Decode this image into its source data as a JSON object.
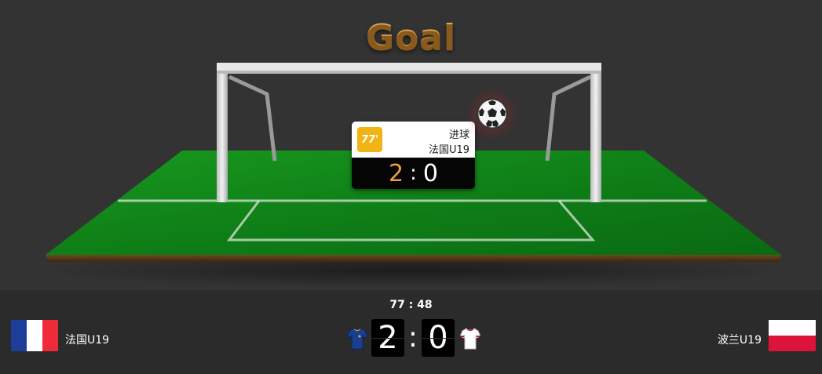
{
  "animation": {
    "title": "Goal",
    "event": {
      "minute": "77'",
      "type": "进球",
      "team": "法国U19",
      "score_home": "2",
      "score_away": "0",
      "separator": ":"
    },
    "icons": {
      "ball": "soccer-ball-icon"
    }
  },
  "scoreboard": {
    "match_clock": "77 : 48",
    "home": {
      "name": "法国U19",
      "flag": "france-flag-icon",
      "kit": "home-jersey-icon",
      "kit_color": "#1b3f8f"
    },
    "away": {
      "name": "波兰U19",
      "flag": "poland-flag-icon",
      "kit": "away-jersey-icon",
      "kit_color": "#ffffff"
    },
    "score_home": "2",
    "score_away": "0",
    "separator": ":"
  },
  "colors": {
    "title_gold": "#e7a043",
    "badge_yellow": "#f0b414",
    "pitch_green": "#138a1c",
    "france_blue": "#1e3f99",
    "france_red": "#ef2b3a",
    "poland_red": "#dc143c"
  }
}
